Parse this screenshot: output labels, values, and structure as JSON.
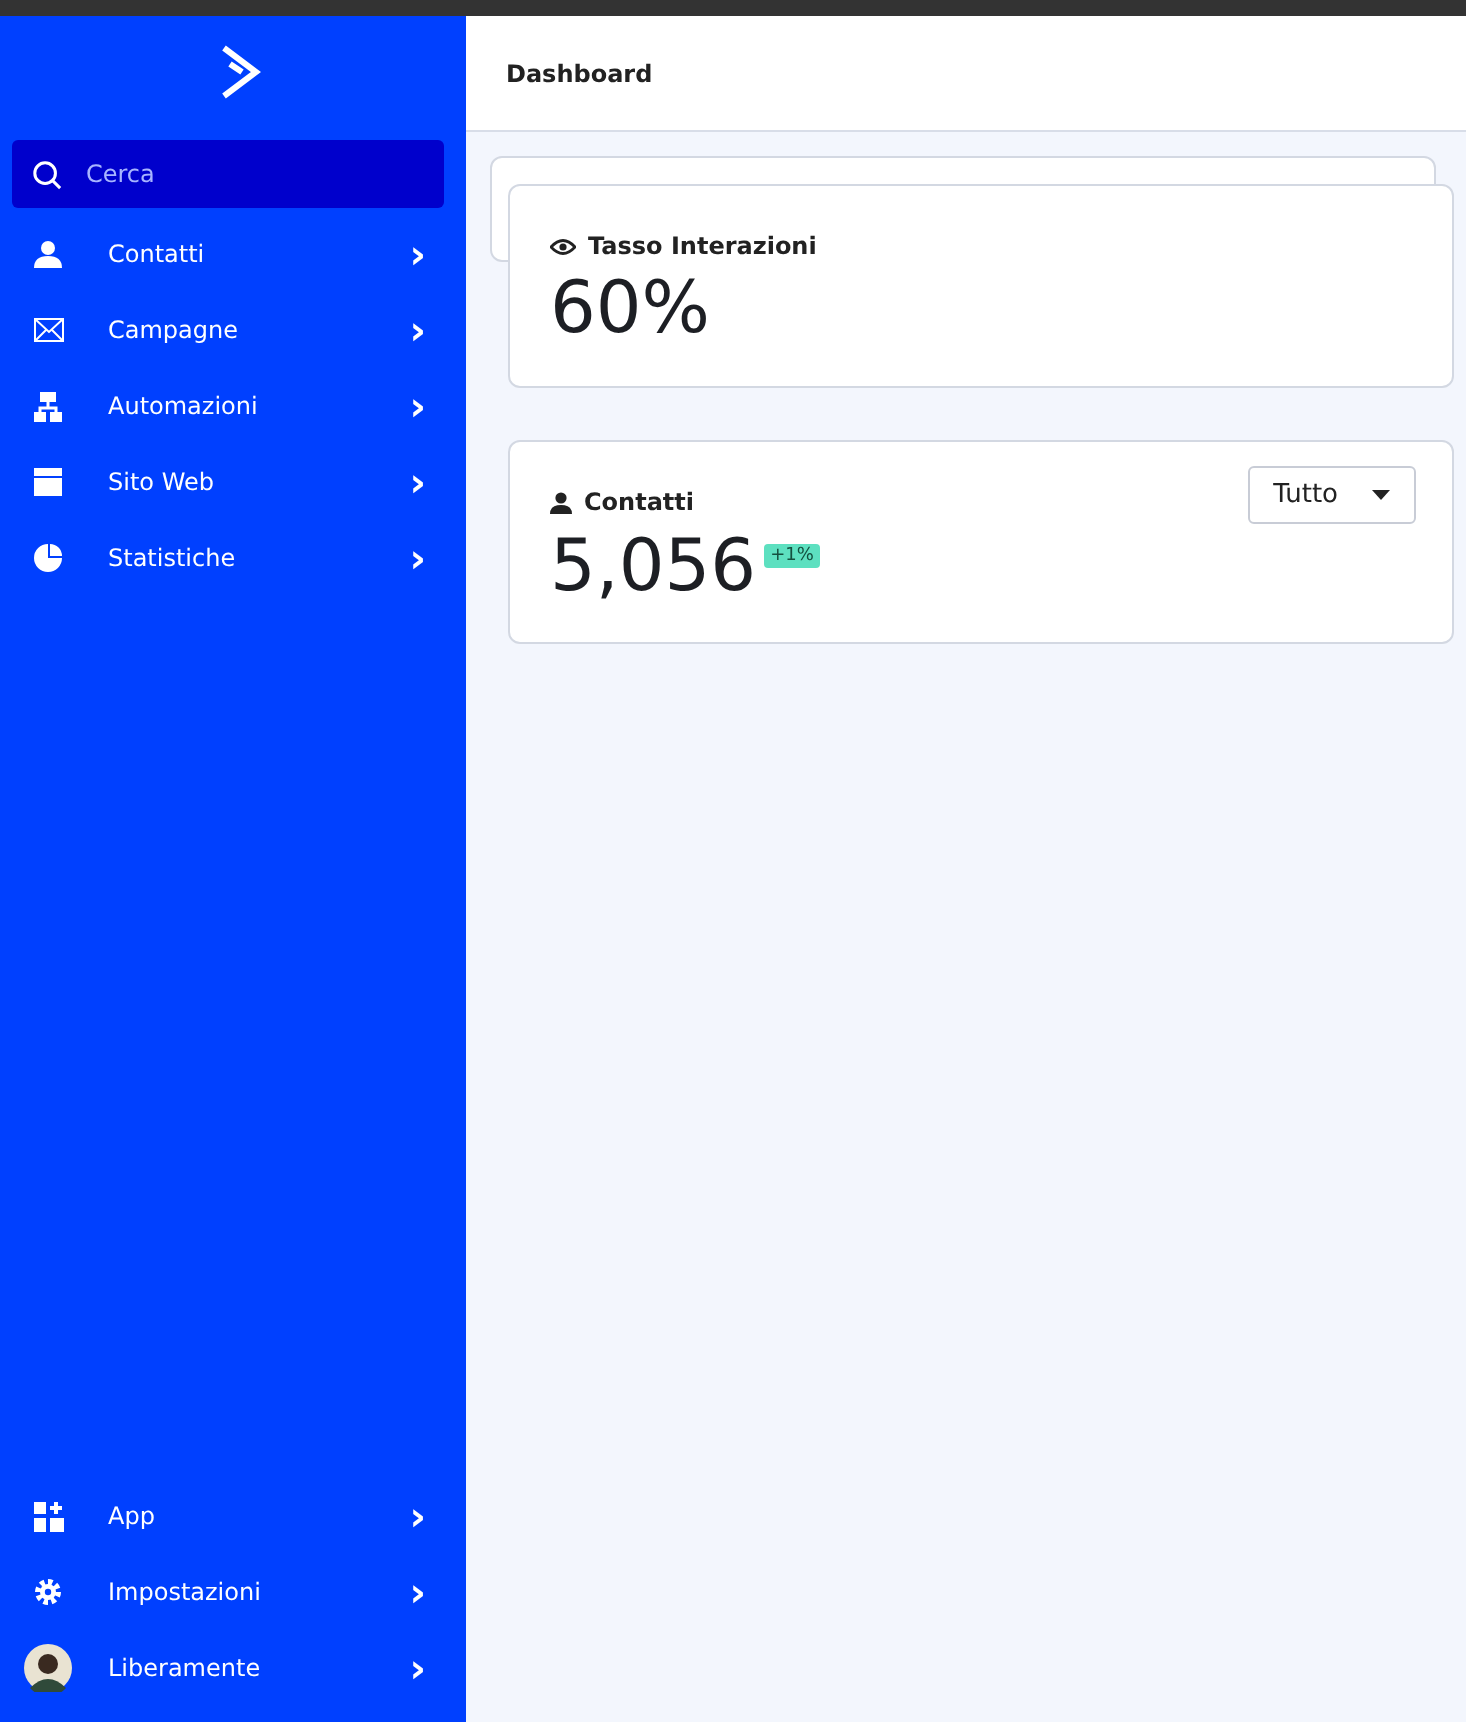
{
  "sidebar": {
    "search": {
      "placeholder": "Cerca"
    },
    "items": [
      {
        "label": "Contatti",
        "chevron": "›"
      },
      {
        "label": "Campagne",
        "chevron": "›"
      },
      {
        "label": "Automazioni",
        "chevron": "›"
      },
      {
        "label": "Sito Web",
        "chevron": "›"
      },
      {
        "label": "Statistiche",
        "chevron": "›"
      }
    ],
    "bottom_items": [
      {
        "label": "App",
        "chevron": "›"
      },
      {
        "label": "Impostazioni",
        "chevron": "›"
      },
      {
        "label": "Liberamente",
        "chevron": "›"
      }
    ]
  },
  "header": {
    "title": "Dashboard"
  },
  "cards": [
    {
      "title": "Tasso Interazioni",
      "value": "60%"
    },
    {
      "title": "Contatti",
      "value": "5,056",
      "badge": "+1%",
      "dropdown": "Tutto"
    }
  ]
}
